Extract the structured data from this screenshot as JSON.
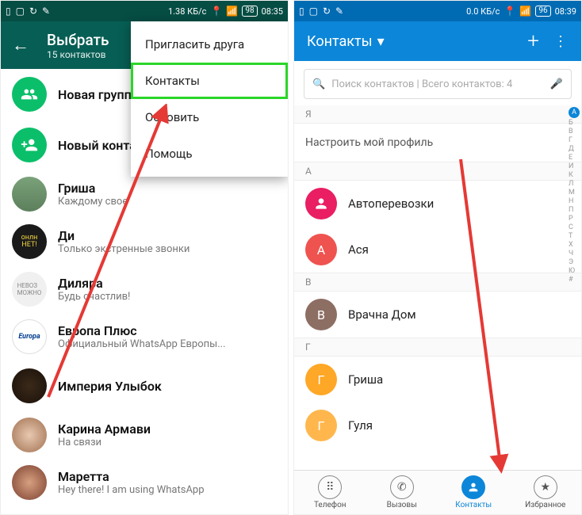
{
  "left": {
    "statusbar": {
      "rate": "1.38 КБ/с",
      "battery": "98",
      "time": "08:35"
    },
    "header": {
      "title": "Выбрать",
      "subtitle": "15 контактов"
    },
    "menu": {
      "items": [
        "Пригласить друга",
        "Контакты",
        "Обновить",
        "Помощь"
      ],
      "highlight_index": 1
    },
    "actions": [
      {
        "name": "Новая группа"
      },
      {
        "name": "Новый контакт"
      }
    ],
    "contacts": [
      {
        "name": "Гриша",
        "status": "Каждому свое"
      },
      {
        "name": "Ди",
        "status": "Только экстренные звонки"
      },
      {
        "name": "Диляра",
        "status": "Будь счастлив!"
      },
      {
        "name": "Европа Плюс",
        "status": "Официальный WhatsApp Европы..."
      },
      {
        "name": "Империя Улыбок",
        "status": ""
      },
      {
        "name": "Карина Армави",
        "status": "На связи"
      },
      {
        "name": "Маретта",
        "status": "Hey there! I am using WhatsApp"
      }
    ]
  },
  "right": {
    "statusbar": {
      "rate": "0.0 КБ/с",
      "battery": "96",
      "time": "08:39"
    },
    "header": {
      "title": "Контакты"
    },
    "search": {
      "placeholder": "Поиск контактов | Всего контактов: 4"
    },
    "profile_row": "Настроить мой профиль",
    "sections": [
      {
        "letter": "Я",
        "rows": []
      },
      {
        "letter": "А",
        "rows": [
          {
            "name": "Автоперевозки",
            "color": "#e91e63",
            "initial": ""
          },
          {
            "name": "Ася",
            "color": "#ef5350",
            "initial": "А"
          }
        ]
      },
      {
        "letter": "В",
        "rows": [
          {
            "name": "Врачна Дом",
            "color": "#8d6e63",
            "initial": "В"
          }
        ]
      },
      {
        "letter": "Г",
        "rows": [
          {
            "name": "Гриша",
            "color": "#ffa726",
            "initial": "Г"
          },
          {
            "name": "Гуля",
            "color": "#ffb74d",
            "initial": "Г"
          }
        ]
      }
    ],
    "index_letters": [
      "А",
      "Б",
      "В",
      "Г",
      "Д",
      "Е",
      "И",
      "К",
      "Л",
      "М",
      "Н",
      "П",
      "Р",
      "С",
      "Т",
      "Х",
      "Ч",
      "Э",
      "Ю",
      "#"
    ],
    "nav": [
      {
        "label": "Телефон",
        "id": "phone"
      },
      {
        "label": "Вызовы",
        "id": "calls"
      },
      {
        "label": "Контакты",
        "id": "contacts"
      },
      {
        "label": "Избранное",
        "id": "fav"
      }
    ],
    "nav_active": 2
  }
}
